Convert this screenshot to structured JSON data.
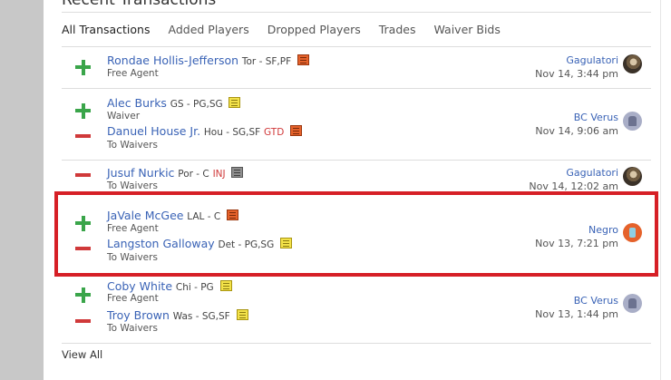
{
  "heading": "Recent Transactions",
  "tabs": [
    "All Transactions",
    "Added Players",
    "Dropped Players",
    "Trades",
    "Waiver Bids"
  ],
  "transactions": [
    {
      "lines": [
        {
          "action": "add",
          "name": "Rondae Hollis-Jefferson",
          "team_pos": "Tor - SF,PF",
          "status": "",
          "note": "orange",
          "sub": "Free Agent"
        }
      ],
      "owner": "Gagulatori",
      "time": "Nov 14, 3:44 pm",
      "avatar": "photo"
    },
    {
      "lines": [
        {
          "action": "add",
          "name": "Alec Burks",
          "team_pos": "GS - PG,SG",
          "status": "",
          "note": "yellow",
          "sub": "Waiver"
        },
        {
          "action": "drop",
          "name": "Danuel House Jr.",
          "team_pos": "Hou - SG,SF",
          "status": "GTD",
          "note": "orange",
          "sub": "To Waivers"
        }
      ],
      "owner": "BC Verus",
      "time": "Nov 14, 9:06 am",
      "avatar": "gray"
    },
    {
      "lines": [
        {
          "action": "drop",
          "name": "Jusuf Nurkic",
          "team_pos": "Por - C",
          "status": "INJ",
          "note": "gray",
          "sub": "To Waivers"
        }
      ],
      "owner": "Gagulatori",
      "time": "Nov 14, 12:02 am",
      "avatar": "photo"
    },
    {
      "lines": [
        {
          "action": "add",
          "name": "JaVale McGee",
          "team_pos": "LAL - C",
          "status": "",
          "note": "orange",
          "sub": "Free Agent"
        },
        {
          "action": "drop",
          "name": "Langston Galloway",
          "team_pos": "Det - PG,SG",
          "status": "",
          "note": "yellow",
          "sub": "To Waivers"
        }
      ],
      "owner": "Negro",
      "time": "Nov 13, 7:21 pm",
      "avatar": "orange"
    },
    {
      "lines": [
        {
          "action": "add",
          "name": "Coby White",
          "team_pos": "Chi - PG",
          "status": "",
          "note": "yellow",
          "sub": "Free Agent"
        },
        {
          "action": "drop",
          "name": "Troy Brown",
          "team_pos": "Was - SG,SF",
          "status": "",
          "note": "yellow",
          "sub": "To Waivers"
        }
      ],
      "owner": "BC Verus",
      "time": "Nov 13, 1:44 pm",
      "avatar": "gray"
    }
  ],
  "view_all": "View All",
  "colors": {
    "accent": "#3a63b6",
    "add": "#3aa54a",
    "drop": "#d0393a",
    "highlight": "#d61f26"
  }
}
